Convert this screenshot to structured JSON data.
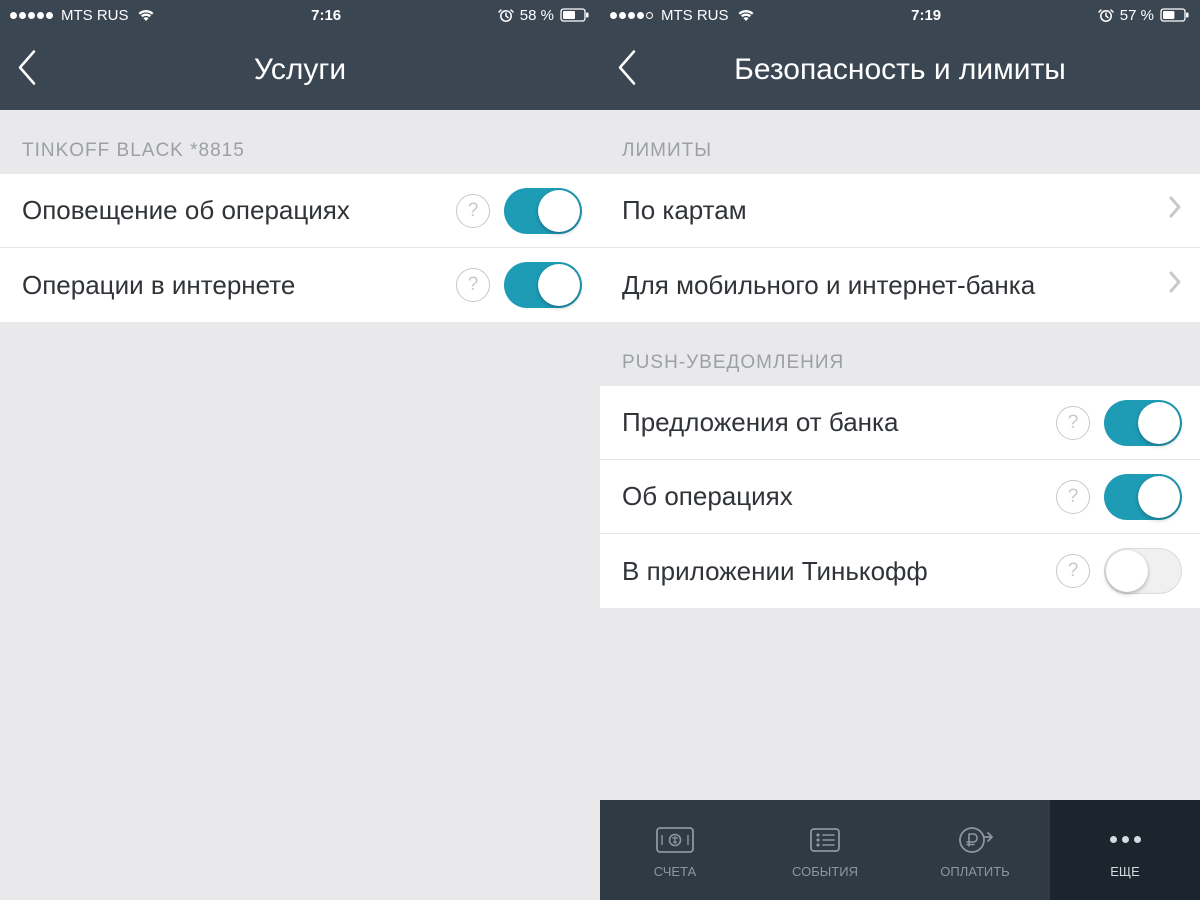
{
  "left": {
    "status": {
      "carrier": "MTS RUS",
      "time": "7:16",
      "battery": "58 %",
      "signal_filled": 5,
      "signal_total": 5
    },
    "nav": {
      "title": "Услуги"
    },
    "section1_label": "TINKOFF BLACK *8815",
    "rows": [
      {
        "label": "Оповещение об операциях",
        "on": true
      },
      {
        "label": "Операции в интернете",
        "on": true
      }
    ]
  },
  "right": {
    "status": {
      "carrier": "MTS RUS",
      "time": "7:19",
      "battery": "57 %",
      "signal_filled": 4,
      "signal_total": 5
    },
    "nav": {
      "title": "Безопасность и лимиты"
    },
    "limits_label": "ЛИМИТЫ",
    "limits_rows": [
      {
        "label": "По картам"
      },
      {
        "label": "Для мобильного и интернет-банка"
      }
    ],
    "push_label": "PUSH-УВЕДОМЛЕНИЯ",
    "push_rows": [
      {
        "label": "Предложения от банка",
        "on": true
      },
      {
        "label": "Об операциях",
        "on": true
      },
      {
        "label": "В приложении Тинькофф",
        "on": false
      }
    ],
    "tabs": [
      {
        "label": "СЧЕТА"
      },
      {
        "label": "СОБЫТИЯ"
      },
      {
        "label": "ОПЛАТИТЬ"
      },
      {
        "label": "ЕЩЕ",
        "active": true
      }
    ]
  },
  "glyphs": {
    "question": "?"
  }
}
